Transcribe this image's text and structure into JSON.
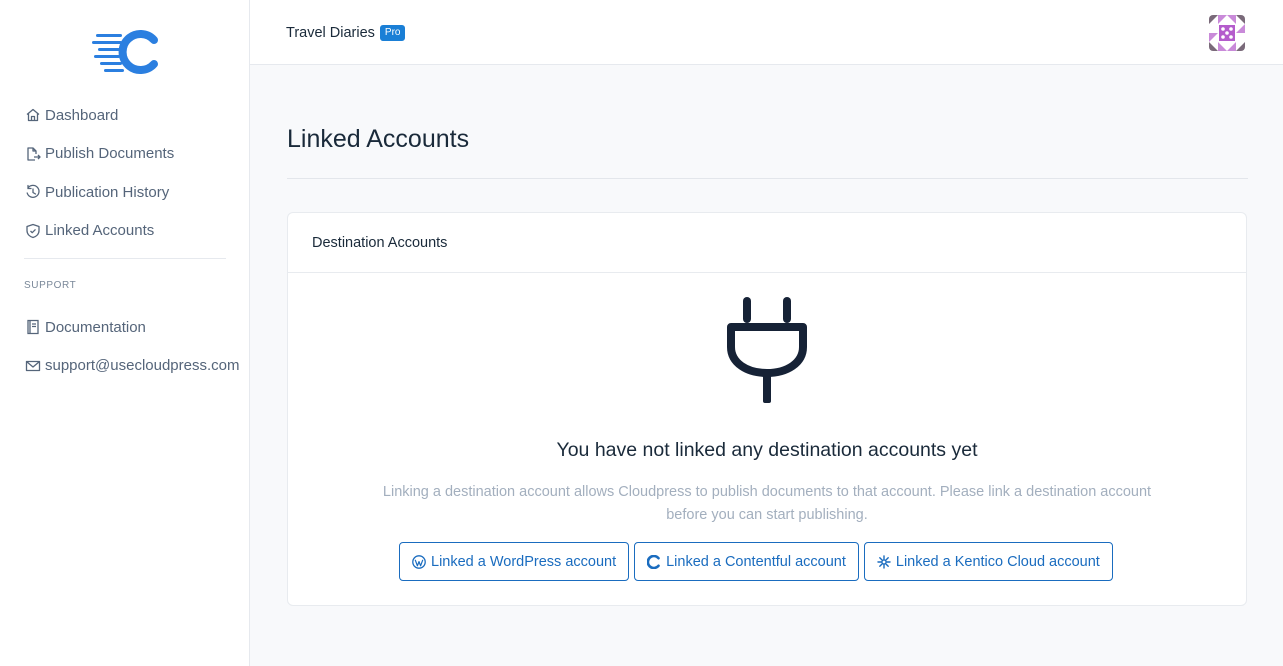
{
  "sidebar": {
    "logo_icon": "cloudpress-logo-icon",
    "items": [
      {
        "label": "Dashboard",
        "icon": "home-icon"
      },
      {
        "label": "Publish Documents",
        "icon": "file-export-icon"
      },
      {
        "label": "Publication History",
        "icon": "history-icon"
      },
      {
        "label": "Linked Accounts",
        "icon": "shield-icon"
      }
    ],
    "support_label": "SUPPORT",
    "support_items": [
      {
        "label": "Documentation",
        "icon": "book-icon"
      },
      {
        "label": "support@usecloudpress.com",
        "icon": "mail-icon"
      }
    ]
  },
  "header": {
    "app_name": "Travel Diaries",
    "badge": "Pro",
    "avatar_icon": "user-avatar-icon"
  },
  "main": {
    "title": "Linked Accounts",
    "card": {
      "title": "Destination Accounts",
      "empty_icon": "plug-icon",
      "empty_title": "You have not linked any destination accounts yet",
      "empty_desc": "Linking a destination account allows Cloudpress to publish documents to that account. Please link a destination account before you can start publishing.",
      "buttons": [
        {
          "label": "Linked a WordPress account",
          "icon": "wordpress-icon"
        },
        {
          "label": "Linked a Contentful account",
          "icon": "contentful-icon"
        },
        {
          "label": "Linked a Kentico Cloud account",
          "icon": "kentico-icon"
        }
      ]
    }
  },
  "colors": {
    "accent": "#1a7fd6",
    "brand": "#2b7fe0",
    "text_dark": "#1a2a3a",
    "text_muted": "#a3afbe"
  }
}
